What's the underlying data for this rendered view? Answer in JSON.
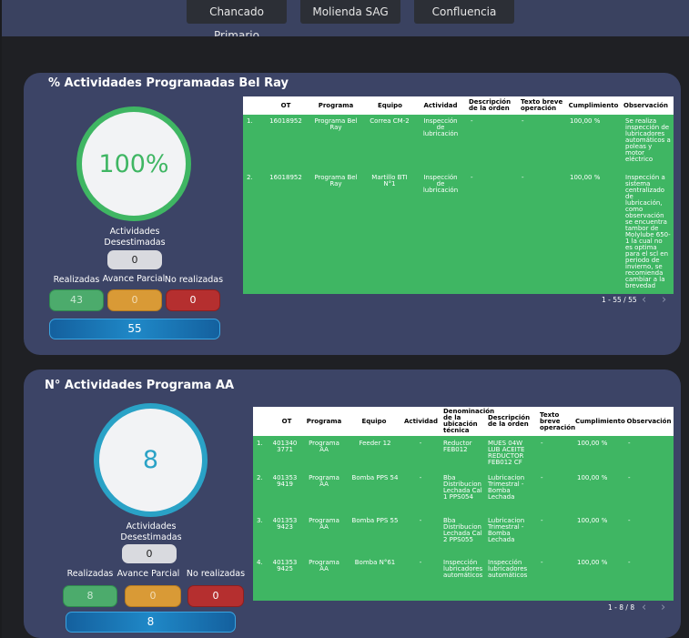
{
  "tabs": [
    "Chancado Primario",
    "Molienda SAG",
    "Confluencia"
  ],
  "colors": {
    "green": "#4cab6c",
    "orange": "#d99a36",
    "red": "#b52f2f",
    "ring1": "#3fb663",
    "ring2": "#2aa2c6"
  },
  "panel1": {
    "title": "% Actividades Programadas Bel Ray",
    "gauge_value": "100%",
    "desestimadas_label": "Actividades Desestimadas",
    "desestimadas_value": "0",
    "realizadas_label": "Realizadas",
    "avance_label": "Avance Parcial",
    "noreal_label": "No realizadas",
    "realizadas_value": "43",
    "avance_value": "0",
    "noreal_value": "0",
    "total_value": "55",
    "columns": [
      "OT",
      "Programa",
      "Equipo",
      "Actividad",
      "Descripción de la orden",
      "Texto breve operación",
      "Cumplimiento",
      "Observación"
    ],
    "rows": [
      {
        "n": "1.",
        "ot": "16018952",
        "programa": "Programa Bel Ray",
        "equipo": "Correa CM-2",
        "actividad": "Inspección de lubricación",
        "desc": "-",
        "texto": "-",
        "cumpl": "100,00 %",
        "obs": "Se realiza inspección de lubricadores automáticos a poleas y motor eléctrico"
      },
      {
        "n": "2.",
        "ot": "16018952",
        "programa": "Programa Bel Ray",
        "equipo": "Martillo BTI N°1",
        "actividad": "Inspección de lubricación",
        "desc": "-",
        "texto": "-",
        "cumpl": "100,00 %",
        "obs": "Inspección a sistema centralizado de lubricación, como observación se encuentra tambor de Molylube 650-1 la cual no es optima para el scl en periodo de invierno, se recomienda cambiar a la brevedad"
      }
    ],
    "pager": "1 - 55 / 55"
  },
  "panel2": {
    "title": "N° Actividades Programa AA",
    "gauge_value": "8",
    "desestimadas_label": "Actividades Desestimadas",
    "desestimadas_value": "0",
    "realizadas_label": "Realizadas",
    "avance_label": "Avance Parcial",
    "noreal_label": "No realizadas",
    "realizadas_value": "8",
    "avance_value": "0",
    "noreal_value": "0",
    "total_value": "8",
    "columns": [
      "OT",
      "Programa",
      "Equipo",
      "Actividad",
      "Denominación de la ubicación técnica",
      "Descripción de la orden",
      "Texto breve operación",
      "Cumplimiento",
      "Observación"
    ],
    "rows": [
      {
        "n": "1.",
        "ot": "4013403771",
        "programa": "Programa AA",
        "equipo": "Feeder 12",
        "actividad": "-",
        "ubic": "Reductor FEB012",
        "desc": "MUES 04W LUB ACEITE REDUCTOR FEB012 CF",
        "texto": "-",
        "cumpl": "100,00 %",
        "obs": "-"
      },
      {
        "n": "2.",
        "ot": "4013539419",
        "programa": "Programa AA",
        "equipo": "Bomba PPS 54",
        "actividad": "-",
        "ubic": "Bba Distribucion Lechada Cal 1 PPS054",
        "desc": "Lubricacion Trimestral - Bomba Lechada",
        "texto": "-",
        "cumpl": "100,00 %",
        "obs": "-"
      },
      {
        "n": "3.",
        "ot": "4013539423",
        "programa": "Programa AA",
        "equipo": "Bomba PPS 55",
        "actividad": "-",
        "ubic": "Bba Distribucion Lechada Cal 2 PPS055",
        "desc": "Lubricacion Trimestral - Bomba Lechada",
        "texto": "-",
        "cumpl": "100,00 %",
        "obs": "-"
      },
      {
        "n": "4.",
        "ot": "4013539425",
        "programa": "Programa AA",
        "equipo": "Bomba N°61",
        "actividad": "-",
        "ubic": "Inspección lubricadores automáticos",
        "desc": "Inspección lubricadores automáticos",
        "texto": "-",
        "cumpl": "100,00 %",
        "obs": "-"
      }
    ],
    "pager": "1 - 8 / 8"
  }
}
